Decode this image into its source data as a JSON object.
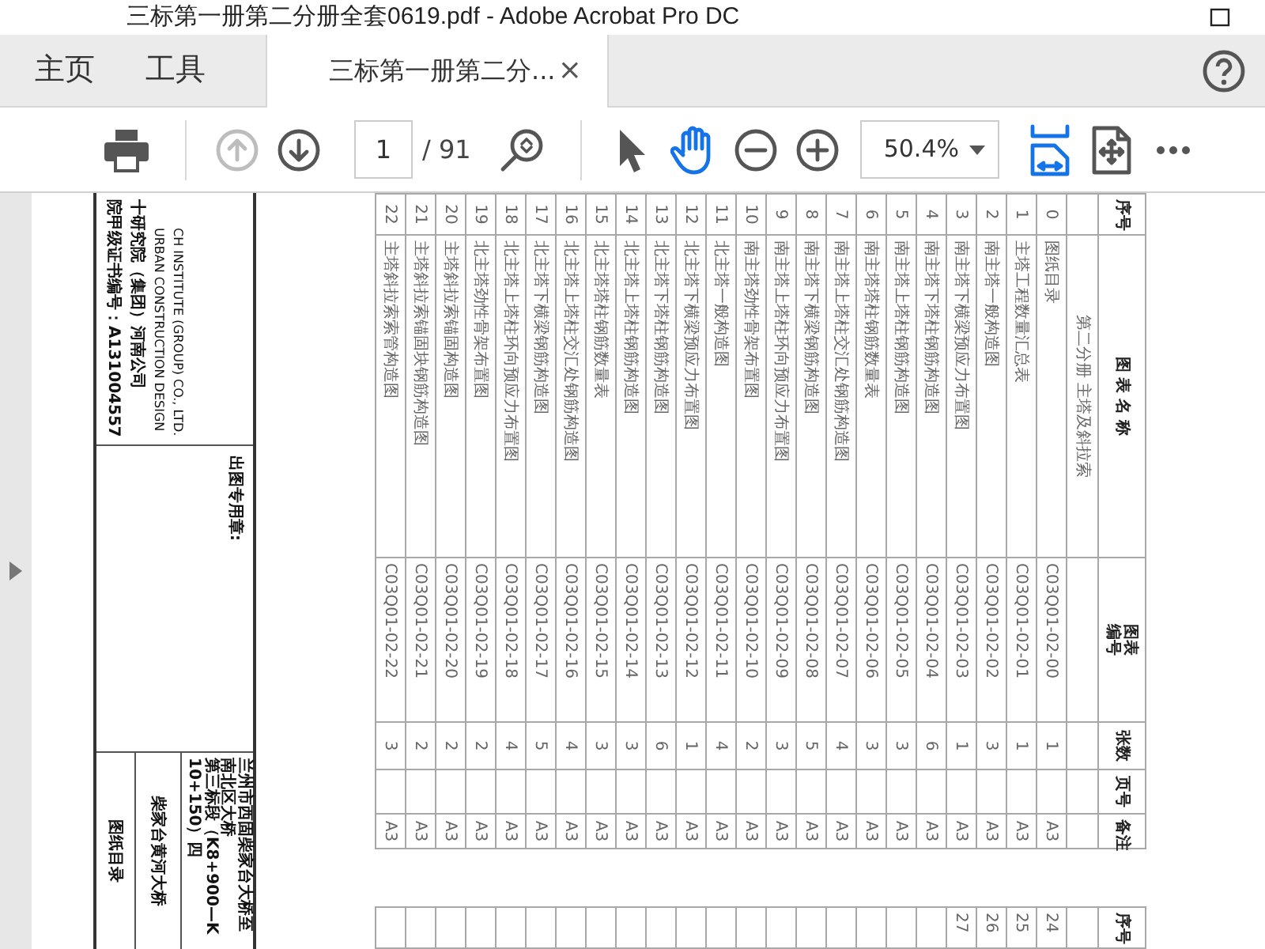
{
  "window": {
    "title": "三标第一册第二分册全套0619.pdf - Adobe Acrobat Pro DC"
  },
  "tabs": [
    {
      "kind": "nav",
      "label": "主页",
      "selected": false
    },
    {
      "kind": "nav",
      "label": "工具",
      "selected": false
    },
    {
      "kind": "document",
      "label": "三标第一册第二分...",
      "close": "×",
      "selected": true
    }
  ],
  "toolbar": [
    [
      {
        "kind": "print",
        "selected": false,
        "disabled": false
      }
    ],
    [
      {
        "kind": "previous-page",
        "selected": false,
        "disabled": true
      },
      {
        "kind": "next-page",
        "selected": false,
        "disabled": false
      },
      {
        "kind": "page-field",
        "value": "1",
        "total": "/ 91"
      },
      {
        "kind": "find-zoom",
        "selected": false,
        "disabled": false
      }
    ],
    [
      {
        "kind": "select",
        "selected": false,
        "disabled": false
      },
      {
        "kind": "hand",
        "selected": true,
        "disabled": false
      },
      {
        "kind": "zoom-out",
        "selected": false,
        "disabled": false
      },
      {
        "kind": "zoom-in",
        "selected": false,
        "disabled": false
      },
      {
        "kind": "zoom-field",
        "value": "50.4%"
      },
      {
        "kind": "fit-width",
        "selected": true,
        "disabled": false
      },
      {
        "kind": "page-arrows",
        "selected": false,
        "disabled": false
      },
      {
        "kind": "more",
        "selected": false,
        "disabled": false
      }
    ]
  ],
  "document": {
    "header": {
      "number": "序号",
      "name": "图 表 名 称",
      "code": "图表编号",
      "sheets": "张数",
      "page": "页号",
      "remark": "备注"
    },
    "section": "第二分册 主塔及斜拉索",
    "rows": [
      {
        "no": "0",
        "name": "图纸目录",
        "code": "C03Q01-02-00",
        "sheets": "1",
        "remark": "A3"
      },
      {
        "no": "1",
        "name": "主塔工程数量汇总表",
        "code": "C03Q01-02-01",
        "sheets": "1",
        "remark": "A3"
      },
      {
        "no": "2",
        "name": "南主塔一般构造图",
        "code": "C03Q01-02-02",
        "sheets": "3",
        "remark": "A3"
      },
      {
        "no": "3",
        "name": "南主塔下横梁预应力布置图",
        "code": "C03Q01-02-03",
        "sheets": "1",
        "remark": "A3"
      },
      {
        "no": "4",
        "name": "南主塔下塔柱钢筋构造图",
        "code": "C03Q01-02-04",
        "sheets": "6",
        "remark": "A3"
      },
      {
        "no": "5",
        "name": "南主塔上塔柱钢筋构造图",
        "code": "C03Q01-02-05",
        "sheets": "3",
        "remark": "A3"
      },
      {
        "no": "6",
        "name": "南主塔塔柱钢筋数量表",
        "code": "C03Q01-02-06",
        "sheets": "3",
        "remark": "A3"
      },
      {
        "no": "7",
        "name": "南主塔上塔柱交汇处钢筋构造图",
        "code": "C03Q01-02-07",
        "sheets": "4",
        "remark": "A3"
      },
      {
        "no": "8",
        "name": "南主塔下横梁钢筋构造图",
        "code": "C03Q01-02-08",
        "sheets": "5",
        "remark": "A3"
      },
      {
        "no": "9",
        "name": "南主塔上塔柱环向预应力布置图",
        "code": "C03Q01-02-09",
        "sheets": "3",
        "remark": "A3"
      },
      {
        "no": "10",
        "name": "南主塔劲性骨架布置图",
        "code": "C03Q01-02-10",
        "sheets": "2",
        "remark": "A3"
      },
      {
        "no": "11",
        "name": "北主塔一般构造图",
        "code": "C03Q01-02-11",
        "sheets": "4",
        "remark": "A3"
      },
      {
        "no": "12",
        "name": "北主塔下横梁预应力布置图",
        "code": "C03Q01-02-12",
        "sheets": "1",
        "remark": "A3"
      },
      {
        "no": "13",
        "name": "北主塔下塔柱钢筋构造图",
        "code": "C03Q01-02-13",
        "sheets": "6",
        "remark": "A3"
      },
      {
        "no": "14",
        "name": "北主塔上塔柱钢筋构造图",
        "code": "C03Q01-02-14",
        "sheets": "3",
        "remark": "A3"
      },
      {
        "no": "15",
        "name": "北主塔塔柱钢筋数量表",
        "code": "C03Q01-02-15",
        "sheets": "3",
        "remark": "A3"
      },
      {
        "no": "16",
        "name": "北主塔上塔柱交汇处钢筋构造图",
        "code": "C03Q01-02-16",
        "sheets": "4",
        "remark": "A3"
      },
      {
        "no": "17",
        "name": "北主塔下横梁钢筋构造图",
        "code": "C03Q01-02-17",
        "sheets": "5",
        "remark": "A3"
      },
      {
        "no": "18",
        "name": "北主塔上塔柱环向预应力布置图",
        "code": "C03Q01-02-18",
        "sheets": "4",
        "remark": "A3"
      },
      {
        "no": "19",
        "name": "北主塔劲性骨架布置图",
        "code": "C03Q01-02-19",
        "sheets": "2",
        "remark": "A3"
      },
      {
        "no": "20",
        "name": "主塔斜拉索锚固构造图",
        "code": "C03Q01-02-20",
        "sheets": "2",
        "remark": "A3"
      },
      {
        "no": "21",
        "name": "主塔斜拉索锚固块钢筋构造图",
        "code": "C03Q01-02-21",
        "sheets": "2",
        "remark": "A3"
      },
      {
        "no": "22",
        "name": "主塔斜拉索索管构造图",
        "code": "C03Q01-02-22",
        "sheets": "3",
        "remark": "A3"
      }
    ],
    "second_table": {
      "header": "序号",
      "numbers": [
        "24",
        "25",
        "26",
        "27"
      ]
    },
    "title_block": {
      "company_lines": [
        {
          "kind": "english",
          "text": "CH INSTITUTE (GROUP) CO., LTD."
        },
        {
          "kind": "english",
          "text": "URBAN CONSTRUCTION DESIGN"
        },
        {
          "kind": "chinese",
          "text": "十研究院（集团）河南公司"
        },
        {
          "kind": "chinese",
          "text": "院甲级证书编号：A131004557"
        }
      ],
      "seal_label": "出图专用章:",
      "project_lines": [
        "兰州市西固柴家台大桥至南北区大桥",
        "第三标段（K8+900—K10+150）四"
      ],
      "bridge": "柴家台黄河大桥",
      "drawing_title": "图纸目录"
    }
  }
}
